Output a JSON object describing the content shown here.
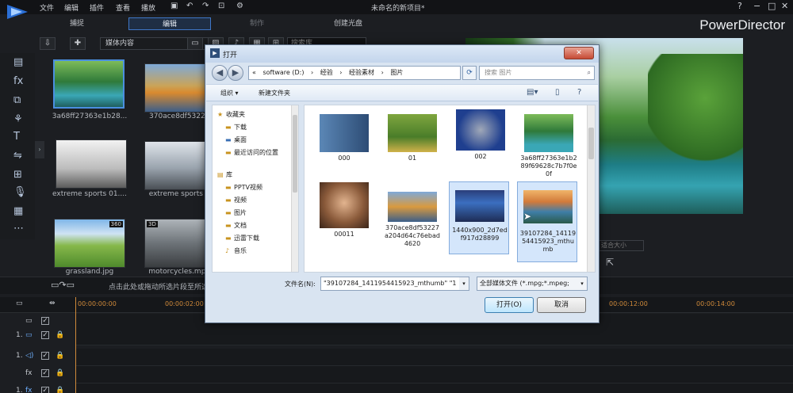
{
  "menu": [
    "文件",
    "编辑",
    "插件",
    "查看",
    "播放"
  ],
  "project_title": "未命名的新项目*",
  "brand": "PowerDirector",
  "window_controls": {
    "help": "?",
    "minimize": "−",
    "restore": "□",
    "close": "✕"
  },
  "mode_tabs": [
    {
      "label": "捕捉",
      "state": "normal"
    },
    {
      "label": "编辑",
      "state": "active"
    },
    {
      "label": "制作",
      "state": "dim"
    },
    {
      "label": "创建光盘",
      "state": "normal"
    }
  ],
  "library": {
    "media_combo": "媒体内容",
    "search_placeholder": "搜索库",
    "items": [
      {
        "label": "3a68ff27363e1b28...",
        "selected": true,
        "badge": ""
      },
      {
        "label": "370ace8df53227a",
        "selected": false,
        "badge": ""
      },
      {
        "label": "extreme sports 01....",
        "selected": false,
        "badge": ""
      },
      {
        "label": "extreme sports 02",
        "selected": false,
        "badge": ""
      },
      {
        "label": "grassland.jpg",
        "selected": false,
        "badge": "360"
      },
      {
        "label": "motorcycles.mpeg",
        "selected": false,
        "badge": "3D"
      }
    ]
  },
  "preview": {
    "combo": "适合大小"
  },
  "timeline": {
    "hint": "点击此处或拖动所选片段至所选",
    "ticks": [
      "00:00:00:00",
      "00:00:02:00",
      "00:00:12:00",
      "00:00:14:00"
    ],
    "tracks": [
      {
        "num": "",
        "type": ""
      },
      {
        "num": "1.",
        "type": "video"
      },
      {
        "num": "1.",
        "type": "audio"
      },
      {
        "num": "",
        "type": "fx"
      },
      {
        "num": "1.",
        "type": "fx"
      }
    ]
  },
  "dialog": {
    "title": "打开",
    "close": "✕",
    "breadcrumb": [
      "«",
      "software (D:)",
      "›",
      "经验",
      "›",
      "经验素材",
      "›",
      "图片"
    ],
    "search_placeholder": "搜索 图片",
    "organize": "组织 ▾",
    "new_folder": "新建文件夹",
    "nav": [
      {
        "label": "收藏夹",
        "indent": 0,
        "icon": "star"
      },
      {
        "label": "下载",
        "indent": 1,
        "icon": "folder"
      },
      {
        "label": "桌面",
        "indent": 1,
        "icon": "folder"
      },
      {
        "label": "最近访问的位置",
        "indent": 1,
        "icon": "folder"
      },
      {
        "label": "库",
        "indent": 0,
        "icon": "library"
      },
      {
        "label": "PPTV视频",
        "indent": 1,
        "icon": "folder"
      },
      {
        "label": "视频",
        "indent": 1,
        "icon": "folder"
      },
      {
        "label": "图片",
        "indent": 1,
        "icon": "folder"
      },
      {
        "label": "文档",
        "indent": 1,
        "icon": "folder"
      },
      {
        "label": "迅雷下载",
        "indent": 1,
        "icon": "folder"
      },
      {
        "label": "音乐",
        "indent": 1,
        "icon": "folder"
      }
    ],
    "files": [
      {
        "name": "000",
        "selected": false
      },
      {
        "name": "01",
        "selected": false
      },
      {
        "name": "002",
        "selected": false
      },
      {
        "name": "3a68ff27363e1b289f69628c7b7f0e0f",
        "selected": false
      },
      {
        "name": "00011",
        "selected": false
      },
      {
        "name": "370ace8df53227a204d64c76ebad4620",
        "selected": false
      },
      {
        "name": "1440x900_2d7edf917d28899",
        "selected": true
      },
      {
        "name": "39107284_1411954415923_mthumb",
        "selected": true
      }
    ],
    "filename_label": "文件名(N):",
    "filename_value": "\"39107284_1411954415923_mthumb\" \"1",
    "filetype": "全部媒体文件 (*.mpg;*.mpeg;",
    "open_button": "打开(O)",
    "cancel_button": "取消"
  }
}
